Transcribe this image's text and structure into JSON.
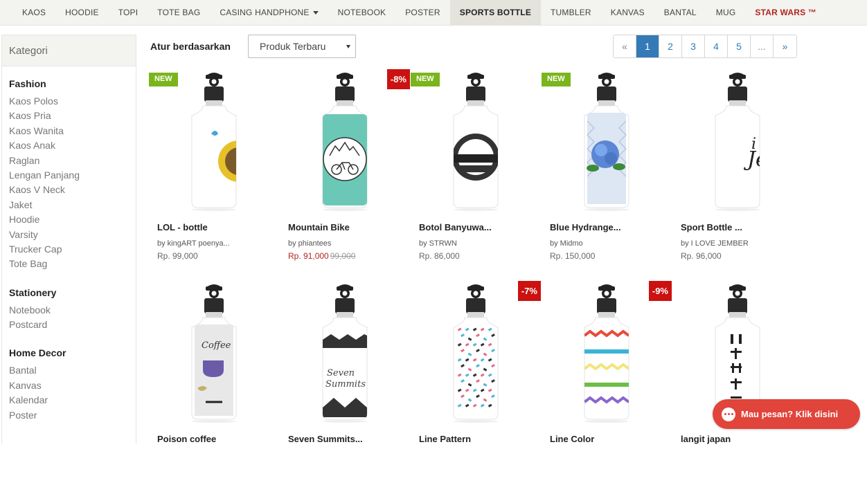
{
  "nav": {
    "items": [
      "KAOS",
      "HOODIE",
      "TOPI",
      "TOTE BAG",
      "CASING HANDPHONE",
      "NOTEBOOK",
      "POSTER",
      "SPORTS BOTTLE",
      "TUMBLER",
      "KANVAS",
      "BANTAL",
      "MUG",
      "STAR WARS ™"
    ],
    "active": "SPORTS BOTTLE"
  },
  "sidebar": {
    "title": "Kategori",
    "groups": [
      {
        "title": "Fashion",
        "items": [
          "Kaos Polos",
          "Kaos Pria",
          "Kaos Wanita",
          "Kaos Anak",
          "Raglan",
          "Lengan Panjang",
          "Kaos V Neck",
          "Jaket",
          "Hoodie",
          "Varsity",
          "Trucker Cap",
          "Tote Bag"
        ]
      },
      {
        "title": "Stationery",
        "items": [
          "Notebook",
          "Postcard"
        ]
      },
      {
        "title": "Home Decor",
        "items": [
          "Bantal",
          "Kanvas",
          "Kalendar",
          "Poster"
        ]
      }
    ]
  },
  "toolbar": {
    "sort_label": "Atur berdasarkan",
    "sort_value": "Produk Terbaru"
  },
  "pagination": {
    "prev": "«",
    "pages": [
      "1",
      "2",
      "3",
      "4",
      "5",
      "..."
    ],
    "next": "»",
    "current": "1"
  },
  "products": [
    {
      "name": "LOL - bottle",
      "by": "by kingART poenya...",
      "price": "Rp. 99,000",
      "old_price": "",
      "badge": "NEW",
      "discount": "",
      "design": "lol"
    },
    {
      "name": "Mountain Bike",
      "by": "by phiantees",
      "price": "Rp. 91,000",
      "old_price": "99,000",
      "badge": "",
      "discount": "-8%",
      "design": "bike"
    },
    {
      "name": "Botol Banyuwa...",
      "by": "by STRWN",
      "price": "Rp. 86,000",
      "old_price": "",
      "badge": "NEW",
      "discount": "",
      "design": "banyuwangi"
    },
    {
      "name": "Blue Hydrange...",
      "by": "by Midmo",
      "price": "Rp. 150,000",
      "old_price": "",
      "badge": "NEW",
      "discount": "",
      "design": "hydrangea"
    },
    {
      "name": "Sport Bottle ...",
      "by": "by I LOVE JEMBER",
      "price": "Rp. 96,000",
      "old_price": "",
      "badge": "",
      "discount": "",
      "design": "jember"
    },
    {
      "name": "Poison coffee",
      "by": "",
      "price": "",
      "old_price": "",
      "badge": "",
      "discount": "",
      "design": "coffee"
    },
    {
      "name": "Seven Summits...",
      "by": "",
      "price": "",
      "old_price": "",
      "badge": "",
      "discount": "",
      "design": "summits"
    },
    {
      "name": "Line Pattern",
      "by": "",
      "price": "",
      "old_price": "",
      "badge": "",
      "discount": "-7%",
      "design": "pattern"
    },
    {
      "name": "Line Color",
      "by": "",
      "price": "",
      "old_price": "",
      "badge": "",
      "discount": "-9%",
      "design": "linecolor"
    },
    {
      "name": "langit japan",
      "by": "",
      "price": "",
      "old_price": "",
      "badge": "",
      "discount": "",
      "design": "japan"
    }
  ],
  "chat": {
    "label": "Mau pesan? Klik disini"
  },
  "colors": {
    "accent": "#337ab7",
    "new_badge": "#7ab51d",
    "discount_badge": "#cc1111",
    "chat": "#e1443b"
  }
}
